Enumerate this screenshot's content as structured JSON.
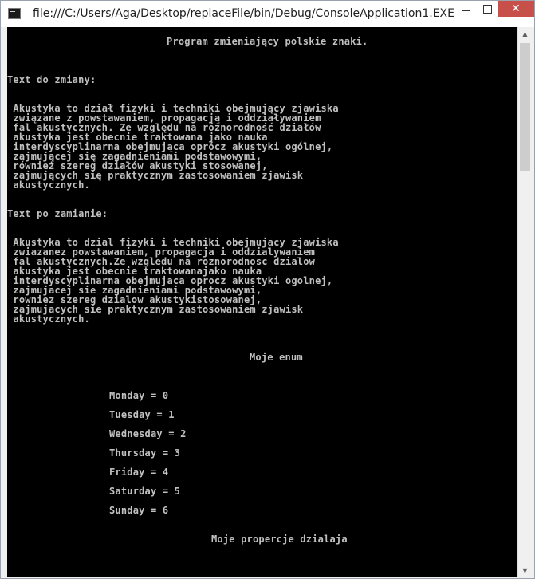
{
  "window": {
    "title": "file:///C:/Users/Aga/Desktop/replaceFile/bin/Debug/ConsoleApplication1.EXE",
    "close_glyph": "✕"
  },
  "console": {
    "header": "Program zmieniający polskie znaki.",
    "label_before": "Text do zmiany:",
    "text_before": [
      " Akustyka to dział fizyki i techniki obejmujący zjawiska",
      " związane z powstawaniem, propagacją i oddziaływaniem",
      " fal akustycznych. Ze względu na różnorodność działów",
      " akustyka jest obecnie traktowana jako nauka",
      " interdyscyplinarna obejmująca oprócz akustyki ogólnej,",
      " zajmującej się zagadnieniami podstawowymi,",
      " również szereg działów akustyki stosowanej,",
      " zajmujących się praktycznym zastosowaniem zjawisk",
      " akustycznych."
    ],
    "label_after": "Text po zamianie:",
    "text_after": [
      " Akustyka to dzial fizyki i techniki obejmujacy zjawiska",
      " zwiazanez powstawaniem, propagacja i oddzialywaniem",
      " fal akustycznych.Ze wzgledu na roznorodnosc dzialow",
      " akustyka jest obecnie traktowanajako nauka",
      " interdyscyplinarna obejmujaca oprocz akustyki ogolnej,",
      " zajmujacej sie zagadnieniami podstawowymi,",
      " rowniez szereg dzialow akustykistosowanej,",
      " zajmujacych sie praktycznym zastosowaniem zjawisk",
      " akustycznych."
    ],
    "enum_title": "Moje enum",
    "enum_items": [
      "Monday = 0",
      "Tuesday = 1",
      "Wednesday = 2",
      "Thursday = 3",
      "Friday = 4",
      "Saturday = 5",
      "Sunday = 6"
    ],
    "properties_title": "Moje propercje dzialaja"
  }
}
